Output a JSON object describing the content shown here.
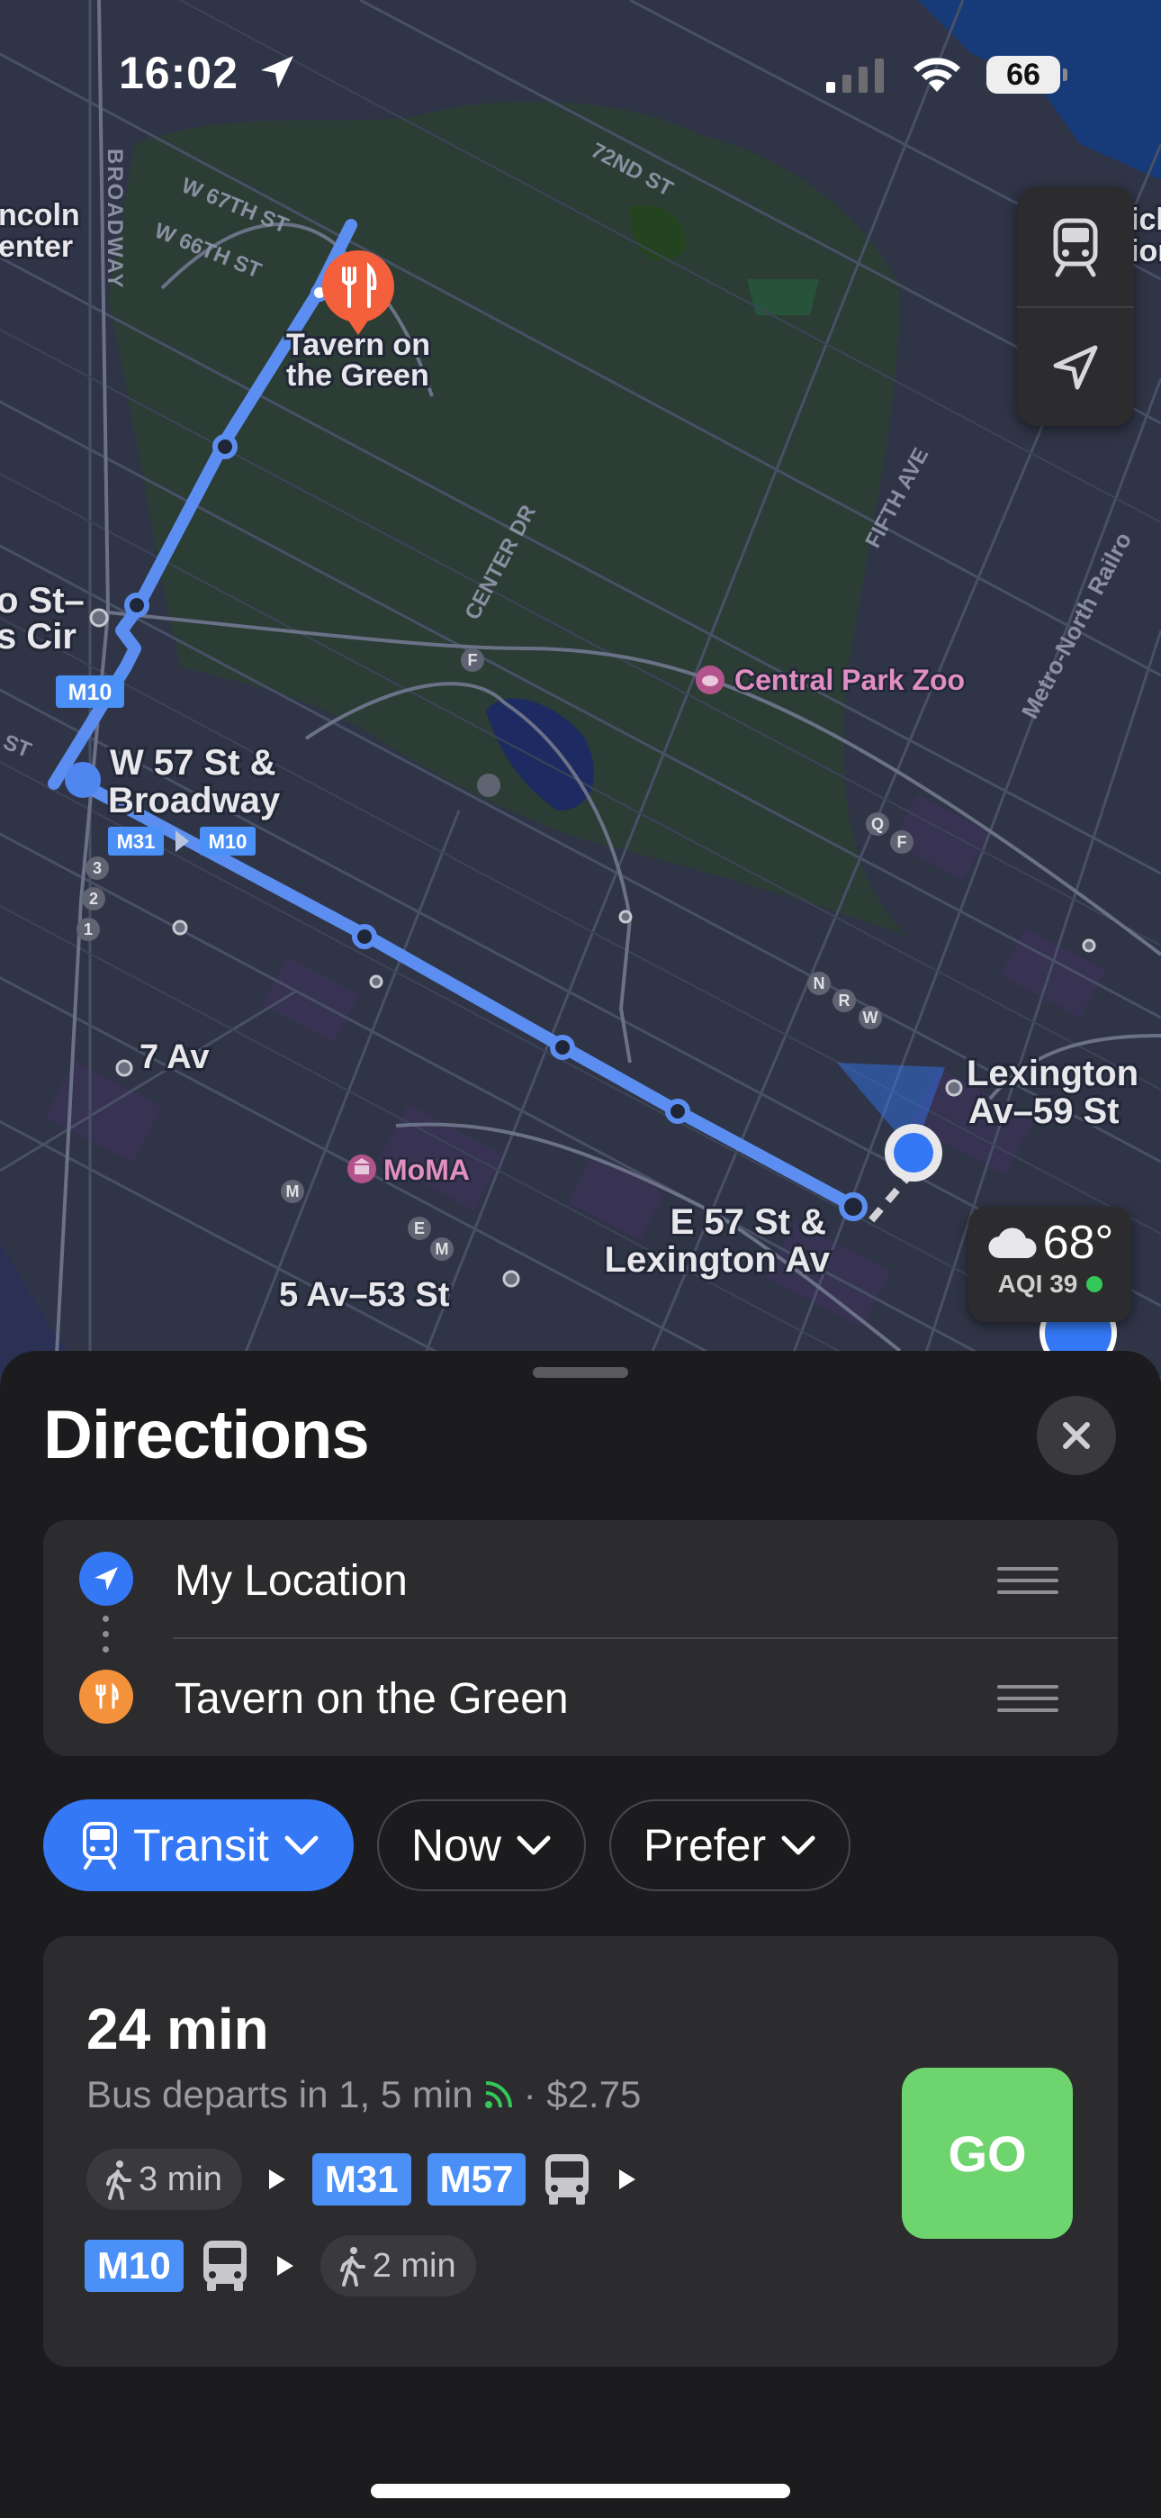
{
  "status_bar": {
    "time": "16:02",
    "battery": "66"
  },
  "map": {
    "labels": {
      "tavern": [
        "Tavern on",
        "the Green"
      ],
      "w57": [
        "W 57 St &",
        "Broadway"
      ],
      "lex_stop": [
        "E 57 St &",
        "Lexington Av"
      ],
      "lex_station": [
        "Lexington",
        "Av–59 St"
      ],
      "seven_av": "7 Av",
      "fifth_53": "5 Av–53 St",
      "moma": "MoMA",
      "zoo": "Central Park Zoo",
      "lincoln": [
        "ncoln",
        "enter"
      ],
      "columbus": [
        "o St–",
        "s Cir"
      ],
      "broadway": "BROADWAY",
      "w67": "W 67TH ST",
      "w66": "W 66TH ST",
      "st72": "72ND ST",
      "center_dr": "CENTER DR",
      "fifth_ave": "FIFTH AVE",
      "metro_north": "Metro-North Railro",
      "right_edge": [
        "ick",
        "ion"
      ],
      "st_left": "ST"
    },
    "route_badges": {
      "m10_top": "M10",
      "m31": "M31",
      "m10": "M10"
    },
    "station_lines": [
      "3",
      "2",
      "1",
      "F",
      "F",
      "Q",
      "N",
      "R",
      "W",
      "M",
      "E",
      "M",
      "M"
    ],
    "controls": {
      "transit_icon": "tram-icon",
      "location_icon": "location-arrow-icon"
    }
  },
  "weather": {
    "temp": "68°",
    "aqi": "AQI 39",
    "aqi_color": "#34c759"
  },
  "sheet": {
    "title": "Directions",
    "waypoints": [
      {
        "label": "My Location",
        "icon": "location-arrow-icon",
        "color": "#3478f6"
      },
      {
        "label": "Tavern on the Green",
        "icon": "fork-knife-icon",
        "color": "#f4923c"
      }
    ],
    "chips": [
      {
        "label": "Transit",
        "active": true
      },
      {
        "label": "Now",
        "active": false
      },
      {
        "label": "Prefer",
        "active": false
      }
    ],
    "route": {
      "duration": "24 min",
      "departs": "Bus departs in 1, 5 min",
      "fare": "· $2.75",
      "steps": {
        "walk_start": "3 min",
        "bus1": "M31",
        "bus2": "M57",
        "bus3": "M10",
        "walk_end": "2 min"
      },
      "go_label": "GO"
    }
  },
  "colors": {
    "route": "#5b8ef0",
    "accent": "#3478f6",
    "go": "#6ed46e",
    "poi_food": "#f4603c"
  }
}
